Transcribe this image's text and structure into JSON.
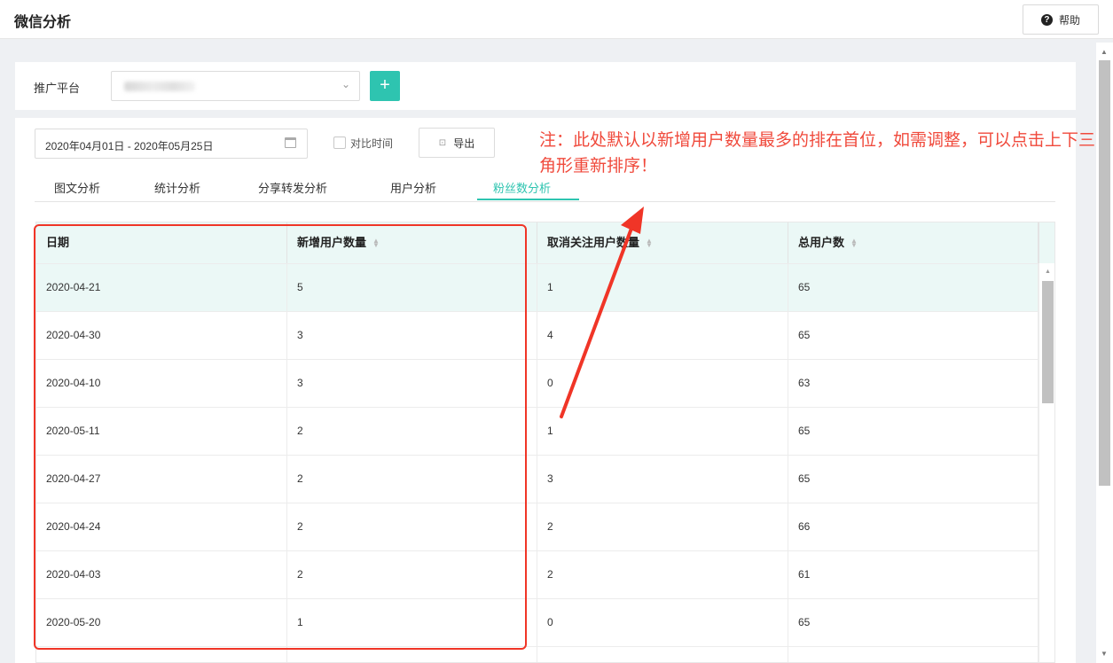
{
  "header": {
    "title": "微信分析",
    "help_label": "帮助",
    "help_icon": "question-circle-icon"
  },
  "platform": {
    "label": "推广平台",
    "caret": "⌄",
    "add_label": "+"
  },
  "toolbar": {
    "date_range": "2020年04月01日 - 2020年05月25日",
    "compare_label": "对比时间",
    "export_label": "导出"
  },
  "tabs": [
    {
      "label": "图文分析"
    },
    {
      "label": "统计分析"
    },
    {
      "label": "分享转发分析"
    },
    {
      "label": "用户分析"
    },
    {
      "label": "粉丝数分析",
      "active": true
    }
  ],
  "annotation": {
    "text": "注：此处默认以新增用户数量最多的排在首位，如需调整，可以点击上下三角形重新排序！",
    "color": "#f04a3c"
  },
  "table": {
    "columns": [
      "日期",
      "新增用户数量",
      "取消关注用户数量",
      "总用户数"
    ],
    "rows": [
      [
        "2020-04-21",
        "5",
        "1",
        "65"
      ],
      [
        "2020-04-30",
        "3",
        "4",
        "65"
      ],
      [
        "2020-04-10",
        "3",
        "0",
        "63"
      ],
      [
        "2020-05-11",
        "2",
        "1",
        "65"
      ],
      [
        "2020-04-27",
        "2",
        "3",
        "65"
      ],
      [
        "2020-04-24",
        "2",
        "2",
        "66"
      ],
      [
        "2020-04-03",
        "2",
        "2",
        "61"
      ],
      [
        "2020-05-20",
        "1",
        "0",
        "65"
      ]
    ]
  },
  "colors": {
    "accent": "#2ec4b0",
    "highlight": "#f03527"
  }
}
